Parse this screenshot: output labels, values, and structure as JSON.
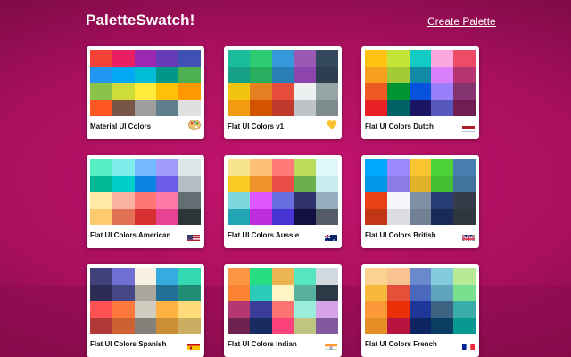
{
  "header": {
    "title": "PaletteSwatch!",
    "create_label": "Create Palette"
  },
  "palettes": [
    {
      "name": "Material UI Colors",
      "icon": "palette-icon",
      "colors": [
        "#f44336",
        "#e91e63",
        "#9c27b0",
        "#673ab7",
        "#3f51b5",
        "#2196f3",
        "#03a9f4",
        "#00bcd4",
        "#009688",
        "#4caf50",
        "#8bc34a",
        "#cddc39",
        "#ffeb3b",
        "#ffc107",
        "#ff9800",
        "#ff5722",
        "#795548",
        "#9e9e9e",
        "#607d8b",
        "#e0e0e0"
      ]
    },
    {
      "name": "Flat UI Colors v1",
      "icon": "heart-icon",
      "colors": [
        "#1abc9c",
        "#2ecc71",
        "#3498db",
        "#9b59b6",
        "#34495e",
        "#16a085",
        "#27ae60",
        "#2980b9",
        "#8e44ad",
        "#2c3e50",
        "#f1c40f",
        "#e67e22",
        "#e74c3c",
        "#ecf0f1",
        "#95a5a6",
        "#f39c12",
        "#d35400",
        "#c0392b",
        "#bdc3c7",
        "#7f8c8d"
      ]
    },
    {
      "name": "Flat UI Colors Dutch",
      "icon": "flag-nl-icon",
      "colors": [
        "#ffc312",
        "#c4e538",
        "#12cbc4",
        "#fda7df",
        "#ed4c67",
        "#f79f1f",
        "#a3cb38",
        "#1289a7",
        "#d980fa",
        "#b53471",
        "#ee5a24",
        "#009432",
        "#0652dd",
        "#9980fa",
        "#833471",
        "#ea2027",
        "#006266",
        "#1b1464",
        "#5758bb",
        "#6f1e51"
      ]
    },
    {
      "name": "Flat UI Colors American",
      "icon": "flag-us-icon",
      "colors": [
        "#55efc4",
        "#81ecec",
        "#74b9ff",
        "#a29bfe",
        "#dfe6e9",
        "#00b894",
        "#00cec9",
        "#0984e3",
        "#6c5ce7",
        "#b2bec3",
        "#ffeaa7",
        "#fab1a0",
        "#ff7675",
        "#fd79a8",
        "#636e72",
        "#fdcb6e",
        "#e17055",
        "#d63031",
        "#e84393",
        "#2d3436"
      ]
    },
    {
      "name": "Flat UI Colors Aussie",
      "icon": "flag-au-icon",
      "colors": [
        "#f6e58d",
        "#ffbe76",
        "#ff7979",
        "#badc58",
        "#dff9fb",
        "#f9ca24",
        "#f0932b",
        "#eb4d4b",
        "#6ab04c",
        "#c7ecee",
        "#7ed6df",
        "#e056fd",
        "#686de0",
        "#30336b",
        "#95afc0",
        "#22a6b3",
        "#be2edd",
        "#4834d4",
        "#130f40",
        "#535c68"
      ]
    },
    {
      "name": "Flat UI Colors British",
      "icon": "flag-gb-icon",
      "colors": [
        "#00a8ff",
        "#9c88ff",
        "#fbc531",
        "#4cd137",
        "#487eb0",
        "#0097e6",
        "#8c7ae6",
        "#e1b12c",
        "#44bd32",
        "#40739e",
        "#e84118",
        "#f5f6fa",
        "#7f8fa6",
        "#273c75",
        "#353b48",
        "#c23616",
        "#dcdde1",
        "#718093",
        "#192a56",
        "#2f3640"
      ]
    },
    {
      "name": "Flat UI Colors Spanish",
      "icon": "flag-es-icon",
      "colors": [
        "#40407a",
        "#706fd3",
        "#f7f1e3",
        "#34ace0",
        "#33d9b2",
        "#2c2c54",
        "#474787",
        "#aaa69d",
        "#227093",
        "#218c74",
        "#ff5252",
        "#ff793f",
        "#d1ccc0",
        "#ffb142",
        "#ffda79",
        "#b33939",
        "#cd6133",
        "#84817a",
        "#cc8e35",
        "#ccae62"
      ]
    },
    {
      "name": "Flat UI Colors Indian",
      "icon": "flag-in-icon",
      "colors": [
        "#fd9644",
        "#26de81",
        "#e9b451",
        "#55e6c1",
        "#d1d8e0",
        "#fa8231",
        "#2bcbba",
        "#fff4c3",
        "#58b19f",
        "#2c3a47",
        "#b33771",
        "#3b3b98",
        "#fd7272",
        "#9aecdb",
        "#d6a2e8",
        "#6d214f",
        "#182c61",
        "#fc427b",
        "#bdc581",
        "#82589f"
      ]
    },
    {
      "name": "Flat UI Colors French",
      "icon": "flag-fr-icon",
      "colors": [
        "#fad390",
        "#f8c291",
        "#6a89cc",
        "#82ccdd",
        "#b8e994",
        "#f6b93b",
        "#e55039",
        "#4a69bd",
        "#60a3bc",
        "#78e08f",
        "#fa983a",
        "#eb2f06",
        "#1e3799",
        "#3c6382",
        "#38ada9",
        "#e58e26",
        "#b71540",
        "#0c2461",
        "#0a3d62",
        "#079992"
      ]
    }
  ]
}
